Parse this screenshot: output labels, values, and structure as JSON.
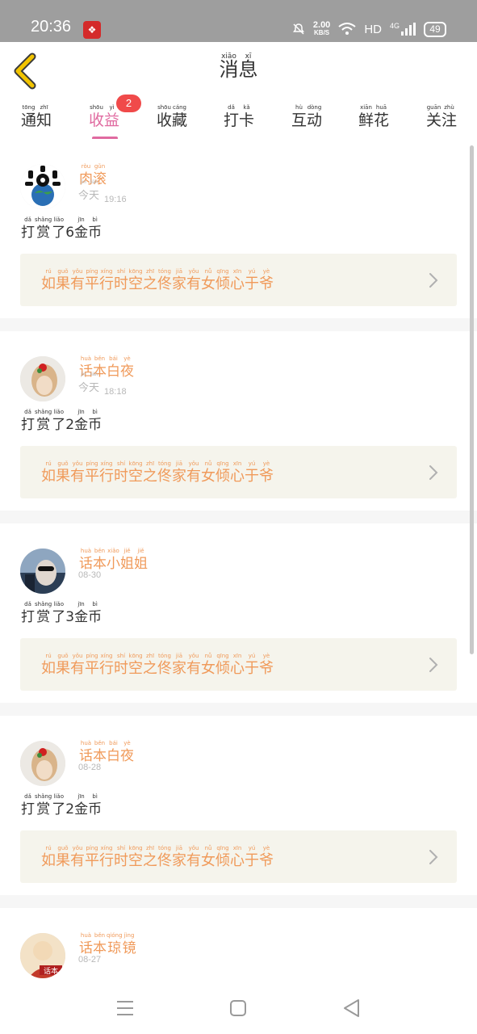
{
  "status_bar": {
    "time": "20:36",
    "speed_value": "2.00",
    "speed_unit": "KB/S",
    "hd": "HD",
    "net_type": "4G",
    "battery": "49",
    "icons": [
      "app-notification-icon",
      "mute-bell-icon",
      "wifi-icon",
      "signal-icon",
      "battery-icon"
    ]
  },
  "header": {
    "title": [
      {
        "py": "xiāo",
        "ch": "消"
      },
      {
        "py": "xī",
        "ch": "息"
      }
    ],
    "back_icon": "chevron-left-icon"
  },
  "tabs": [
    {
      "chars": [
        {
          "py": "tōng",
          "ch": "通"
        },
        {
          "py": "zhī",
          "ch": "知"
        }
      ],
      "active": false
    },
    {
      "chars": [
        {
          "py": "shōu",
          "ch": "收"
        },
        {
          "py": "yì",
          "ch": "益"
        }
      ],
      "active": true,
      "badge": "2"
    },
    {
      "chars": [
        {
          "py": "shōu",
          "ch": "收"
        },
        {
          "py": "cáng",
          "ch": "藏"
        }
      ],
      "active": false
    },
    {
      "chars": [
        {
          "py": "dǎ",
          "ch": "打"
        },
        {
          "py": "kǎ",
          "ch": "卡"
        }
      ],
      "active": false
    },
    {
      "chars": [
        {
          "py": "hù",
          "ch": "互"
        },
        {
          "py": "dòng",
          "ch": "动"
        }
      ],
      "active": false
    },
    {
      "chars": [
        {
          "py": "xiān",
          "ch": "鲜"
        },
        {
          "py": "huā",
          "ch": "花"
        }
      ],
      "active": false
    },
    {
      "chars": [
        {
          "py": "guān",
          "ch": "关"
        },
        {
          "py": "zhù",
          "ch": "注"
        }
      ],
      "active": false
    }
  ],
  "colors": {
    "accent_pink": "#e06aa0",
    "name_orange": "#f09a5a",
    "badge_red": "#f04a4a",
    "box_bg": "#f5f4ec"
  },
  "messages": [
    {
      "name": [
        {
          "py": "ròu",
          "ch": "肉"
        },
        {
          "py": "gǔn",
          "ch": "滚"
        }
      ],
      "date_chars": [
        {
          "py": "jīn",
          "ch": "今"
        },
        {
          "py": "tiān",
          "ch": "天"
        }
      ],
      "time": "19:16",
      "action": [
        {
          "py": "dǎ",
          "ch": "打"
        },
        {
          "py": "shǎng",
          "ch": "赏"
        },
        {
          "py": "liǎo",
          "ch": "了"
        },
        {
          "py": "",
          "ch": "6"
        },
        {
          "py": "jīn",
          "ch": "金"
        },
        {
          "py": "bì",
          "ch": "币"
        }
      ],
      "avatar": "avatar-globe-icon"
    },
    {
      "name": [
        {
          "py": "huà",
          "ch": "话"
        },
        {
          "py": "běn",
          "ch": "本"
        },
        {
          "py": "bái",
          "ch": "白"
        },
        {
          "py": "yè",
          "ch": "夜"
        }
      ],
      "date_chars": [
        {
          "py": "jīn",
          "ch": "今"
        },
        {
          "py": "tiān",
          "ch": "天"
        }
      ],
      "time": "18:18",
      "action": [
        {
          "py": "dǎ",
          "ch": "打"
        },
        {
          "py": "shǎng",
          "ch": "赏"
        },
        {
          "py": "liǎo",
          "ch": "了"
        },
        {
          "py": "",
          "ch": "2"
        },
        {
          "py": "jīn",
          "ch": "金"
        },
        {
          "py": "bì",
          "ch": "币"
        }
      ],
      "avatar": "avatar-girl-flower-icon"
    },
    {
      "name": [
        {
          "py": "huà",
          "ch": "话"
        },
        {
          "py": "běn",
          "ch": "本"
        },
        {
          "py": "xiǎo",
          "ch": "小"
        },
        {
          "py": "jiě",
          "ch": "姐"
        },
        {
          "py": "jiě",
          "ch": "姐"
        }
      ],
      "date_chars": [],
      "time": "08-30",
      "action": [
        {
          "py": "dǎ",
          "ch": "打"
        },
        {
          "py": "shǎng",
          "ch": "赏"
        },
        {
          "py": "liǎo",
          "ch": "了"
        },
        {
          "py": "",
          "ch": "3"
        },
        {
          "py": "jīn",
          "ch": "金"
        },
        {
          "py": "bì",
          "ch": "币"
        }
      ],
      "avatar": "avatar-sunglasses-icon"
    },
    {
      "name": [
        {
          "py": "huà",
          "ch": "话"
        },
        {
          "py": "běn",
          "ch": "本"
        },
        {
          "py": "bái",
          "ch": "白"
        },
        {
          "py": "yè",
          "ch": "夜"
        }
      ],
      "date_chars": [],
      "time": "08-28",
      "action": [
        {
          "py": "dǎ",
          "ch": "打"
        },
        {
          "py": "shǎng",
          "ch": "赏"
        },
        {
          "py": "liǎo",
          "ch": "了"
        },
        {
          "py": "",
          "ch": "2"
        },
        {
          "py": "jīn",
          "ch": "金"
        },
        {
          "py": "bì",
          "ch": "币"
        }
      ],
      "avatar": "avatar-girl-flower-icon"
    },
    {
      "name": [
        {
          "py": "huà",
          "ch": "话"
        },
        {
          "py": "běn",
          "ch": "本"
        },
        {
          "py": "qióng",
          "ch": "琼"
        },
        {
          "py": "jìng",
          "ch": "镜"
        }
      ],
      "date_chars": [],
      "time": "08-27",
      "action": [],
      "avatar": "avatar-book-cover-icon"
    }
  ],
  "book_title": [
    {
      "py": "rú",
      "ch": "如"
    },
    {
      "py": "guǒ",
      "ch": "果"
    },
    {
      "py": "yǒu",
      "ch": "有"
    },
    {
      "py": "píng",
      "ch": "平"
    },
    {
      "py": "xíng",
      "ch": "行"
    },
    {
      "py": "shí",
      "ch": "时"
    },
    {
      "py": "kōng",
      "ch": "空"
    },
    {
      "py": "zhī",
      "ch": "之"
    },
    {
      "py": "tóng",
      "ch": "佟"
    },
    {
      "py": "jiā",
      "ch": "家"
    },
    {
      "py": "yǒu",
      "ch": "有"
    },
    {
      "py": "nǚ",
      "ch": "女"
    },
    {
      "py": "qīng",
      "ch": "倾"
    },
    {
      "py": "xīn",
      "ch": "心"
    },
    {
      "py": "yú",
      "ch": "于"
    },
    {
      "py": "yè",
      "ch": "爷"
    }
  ],
  "nav_bar": [
    "menu-icon",
    "home-square-icon",
    "back-triangle-icon"
  ]
}
